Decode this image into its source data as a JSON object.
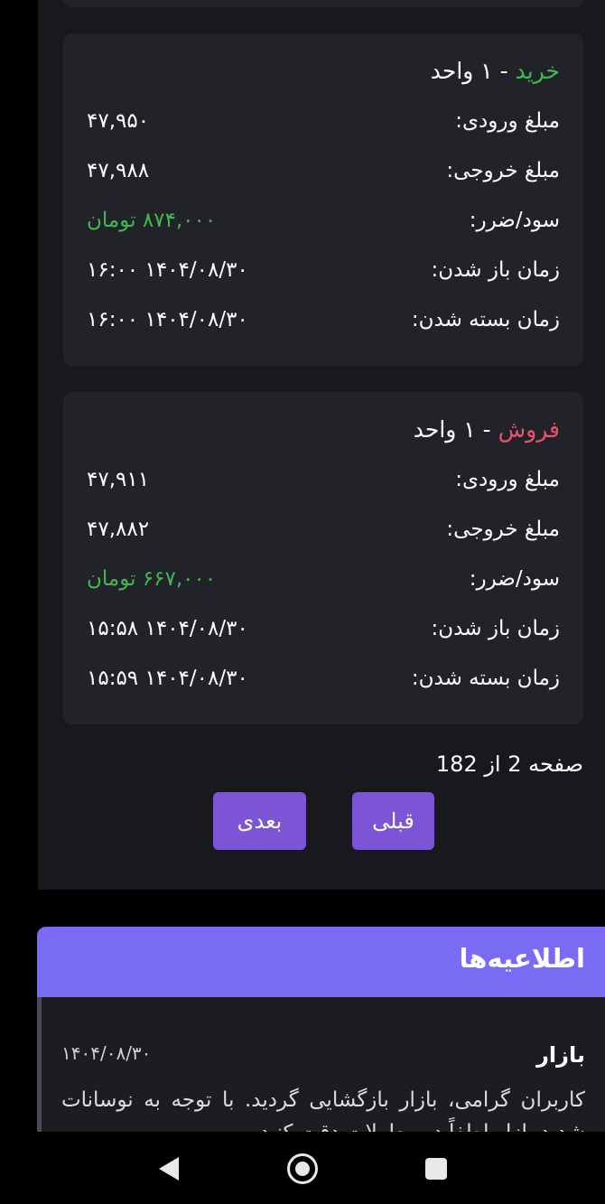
{
  "trades": [
    {
      "type": "خرید",
      "units_text": " - ۱ واحد",
      "rows": [
        {
          "label": "مبلغ ورودی:",
          "value": "۴۷,۹۵۰"
        },
        {
          "label": "مبلغ خروجی:",
          "value": "۴۷,۹۸۸"
        },
        {
          "label": "سود/ضرر:",
          "value": "۸۷۴,۰۰۰ تومان"
        },
        {
          "label": "زمان باز شدن:",
          "value": "۱۴۰۴/۰۸/۳۰ ۱۶:۰۰"
        },
        {
          "label": "زمان بسته شدن:",
          "value": "۱۴۰۴/۰۸/۳۰ ۱۶:۰۰"
        }
      ]
    },
    {
      "type": "فروش",
      "units_text": " - ۱ واحد",
      "rows": [
        {
          "label": "مبلغ ورودی:",
          "value": "۴۷,۹۱۱"
        },
        {
          "label": "مبلغ خروجی:",
          "value": "۴۷,۸۸۲"
        },
        {
          "label": "سود/ضرر:",
          "value": "۶۶۷,۰۰۰ تومان"
        },
        {
          "label": "زمان باز شدن:",
          "value": "۱۴۰۴/۰۸/۳۰ ۱۵:۵۸"
        },
        {
          "label": "زمان بسته شدن:",
          "value": "۱۴۰۴/۰۸/۳۰ ۱۵:۵۹"
        }
      ]
    }
  ],
  "pagination": {
    "page_text": "صفحه 2 از 182",
    "next_label": "بعدی",
    "prev_label": "قبلی"
  },
  "announcements": {
    "title": "اطلاعیه‌ها",
    "items": [
      {
        "title": "بازار",
        "date": "۱۴۰۴/۰۸/۳۰",
        "text": "کاربران گرامی، بازار بازگشایی گردید. با توجه به نوسانات شدید بازار لطفاً در معاملات دقت کنید"
      }
    ]
  },
  "colors": {
    "buy": "#3fb950",
    "sell": "#f0506e",
    "profit": "#3fb950",
    "button": "#7b55d6",
    "header": "#7a6bf5"
  }
}
